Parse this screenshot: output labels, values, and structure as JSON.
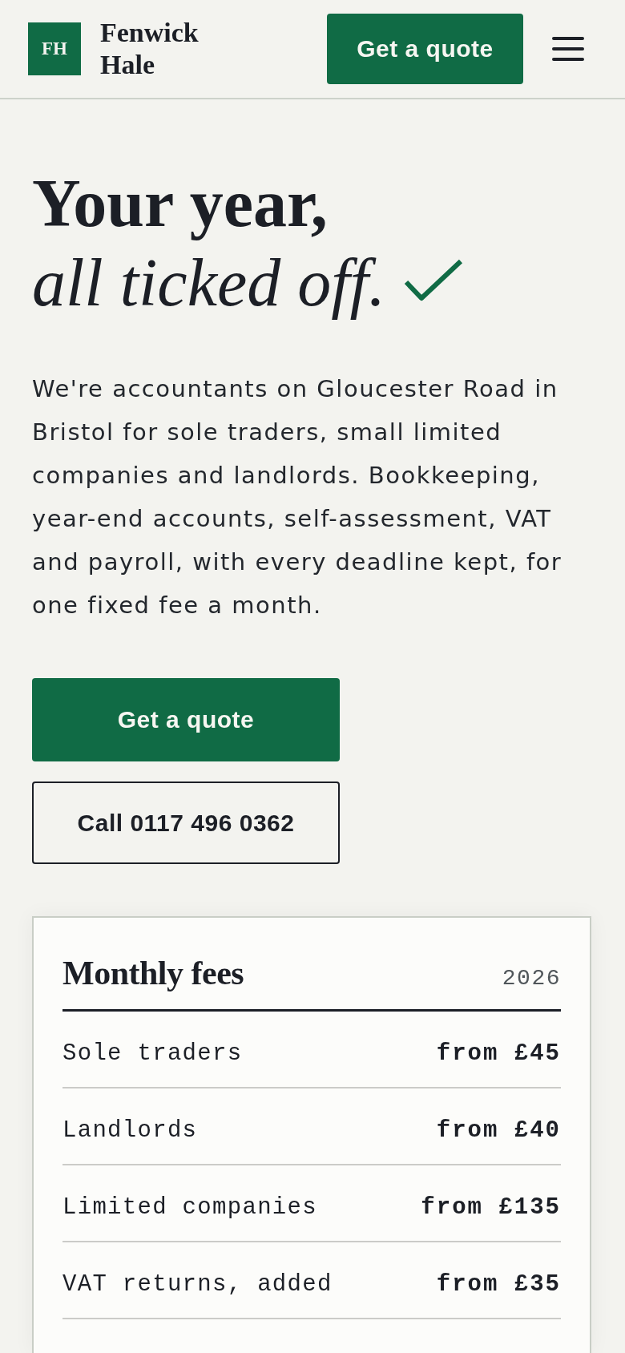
{
  "header": {
    "logo_initials": "FH",
    "brand_name": "Fenwick Hale",
    "cta": "Get a quote"
  },
  "hero": {
    "title_line_1": "Your year,",
    "title_line_2": "all ticked off.",
    "intro": "We're accountants on Gloucester Road in Bristol for sole traders, small limited companies and landlords. Bookkeeping, year-end accounts, self-assessment, VAT and payroll, with every deadline kept, for one fixed fee a month.",
    "buttons": [
      {
        "label": "Get a quote",
        "kind": "primary"
      },
      {
        "label": "Call 0117 496 0362",
        "kind": "secondary"
      }
    ]
  },
  "fees_card": {
    "title": "Monthly fees",
    "year": "2026",
    "rows": [
      {
        "service": "Sole traders",
        "price": "from £45"
      },
      {
        "service": "Landlords",
        "price": "from £40"
      },
      {
        "service": "Limited companies",
        "price": "from £135"
      },
      {
        "service": "VAT returns, added",
        "price": "from £35"
      }
    ]
  }
}
